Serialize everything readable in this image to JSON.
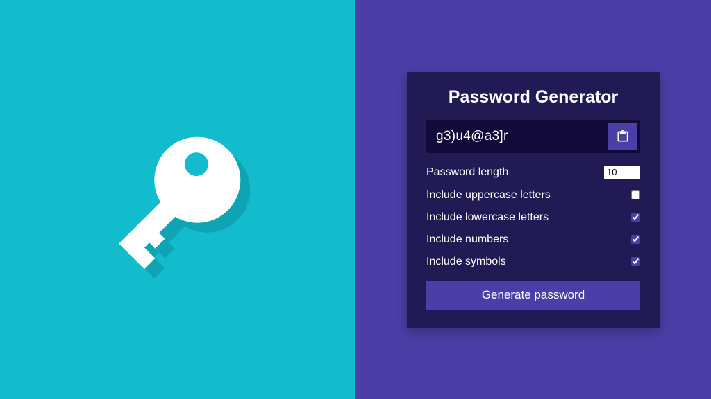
{
  "title": "Password Generator",
  "result": "g3)u4@a3]r",
  "settings": {
    "length_label": "Password length",
    "length_value": "10",
    "uppercase_label": "Include uppercase letters",
    "uppercase_checked": false,
    "lowercase_label": "Include lowercase letters",
    "lowercase_checked": true,
    "numbers_label": "Include numbers",
    "numbers_checked": true,
    "symbols_label": "Include symbols",
    "symbols_checked": true
  },
  "generate_label": "Generate password",
  "colors": {
    "left_bg": "#12bccc",
    "right_bg": "#4b3fa7",
    "card_bg": "#221a54",
    "result_bg": "#120b3a",
    "accent": "#4b3fa7",
    "key_shadow": "#0fa4b3"
  }
}
